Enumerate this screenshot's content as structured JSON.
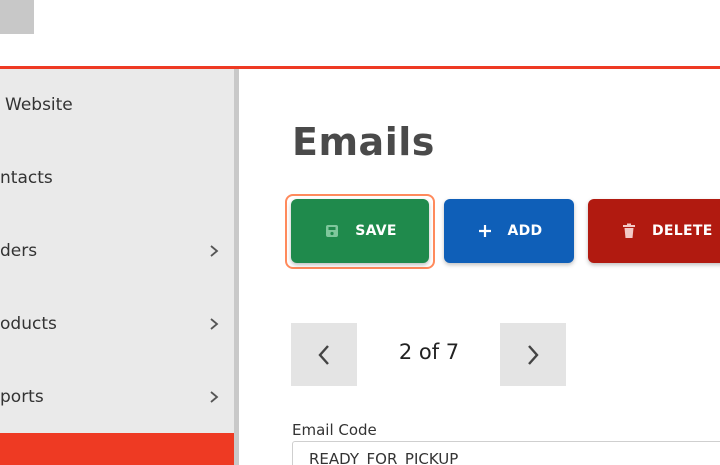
{
  "header": {
    "logo_icon": "logo-block"
  },
  "colors": {
    "accent": "#ee3a23",
    "save": "#1f8a4c",
    "add": "#0f5fb8",
    "delete": "#b11a10",
    "focus_ring": "#ff8a5c"
  },
  "sidebar": {
    "items": [
      {
        "label": "Website",
        "has_chevron": false
      },
      {
        "label": "ntacts",
        "has_chevron": false
      },
      {
        "label": "ders",
        "has_chevron": true
      },
      {
        "label": "oducts",
        "has_chevron": true
      },
      {
        "label": "ports",
        "has_chevron": true
      }
    ]
  },
  "main": {
    "title": "Emails",
    "buttons": {
      "save_label": "SAVE",
      "add_label": "ADD",
      "delete_label": "DELETE"
    },
    "pager": {
      "text": "2 of 7"
    },
    "email_code": {
      "label": "Email Code",
      "value": "READY_FOR_PICKUP"
    }
  }
}
